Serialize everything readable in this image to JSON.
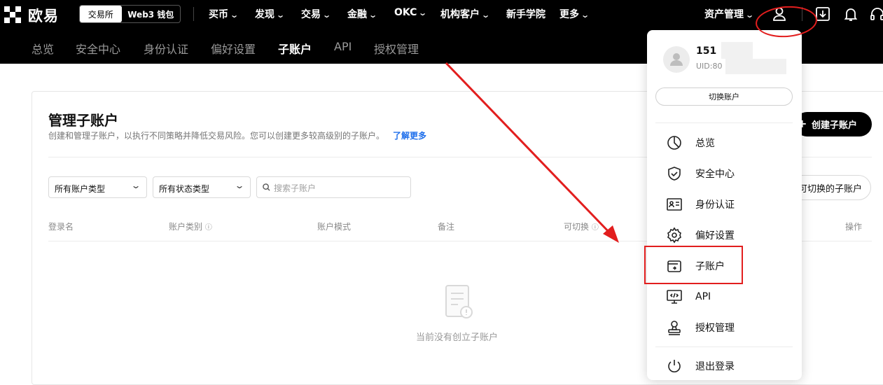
{
  "header": {
    "logo_text": "欧易",
    "switch_exchange": "交易所",
    "switch_web3": "Web3 钱包",
    "nav": [
      "买币",
      "发现",
      "交易",
      "金融",
      "OKC",
      "机构客户",
      "新手学院",
      "更多"
    ],
    "asset_management": "资产管理"
  },
  "subnav": [
    "总览",
    "安全中心",
    "身份认证",
    "偏好设置",
    "子账户",
    "API",
    "授权管理"
  ],
  "subnav_active": "子账户",
  "main": {
    "title": "管理子账户",
    "description": "创建和管理子账户，以执行不同策略并降低交易风险。您可以创建更多较高级别的子账户。",
    "learn_more": "了解更多",
    "filter_account_type": "所有账户类型",
    "filter_status_type": "所有状态类型",
    "search_placeholder": "搜索子账户",
    "columns": [
      "登录名",
      "账户类别",
      "账户模式",
      "备注",
      "可切换",
      "操作"
    ],
    "empty_text": "当前没有创立子账户",
    "create_button": "创建子账户",
    "switchable_button": "可切换的子账户"
  },
  "dropdown": {
    "user_name": "151",
    "uid": "UID:80",
    "switch_account": "切换账户",
    "items": [
      "总览",
      "安全中心",
      "身份认证",
      "偏好设置",
      "子账户",
      "API",
      "授权管理",
      "退出登录"
    ],
    "highlighted": "子账户"
  },
  "colors": {
    "highlight": "#e21e1e",
    "link": "#1f6feb",
    "topbar": "#000000"
  },
  "icons": [
    "user-icon",
    "download-icon",
    "bell-icon",
    "headset-icon",
    "search-icon",
    "info-icon",
    "empty-document-icon"
  ]
}
